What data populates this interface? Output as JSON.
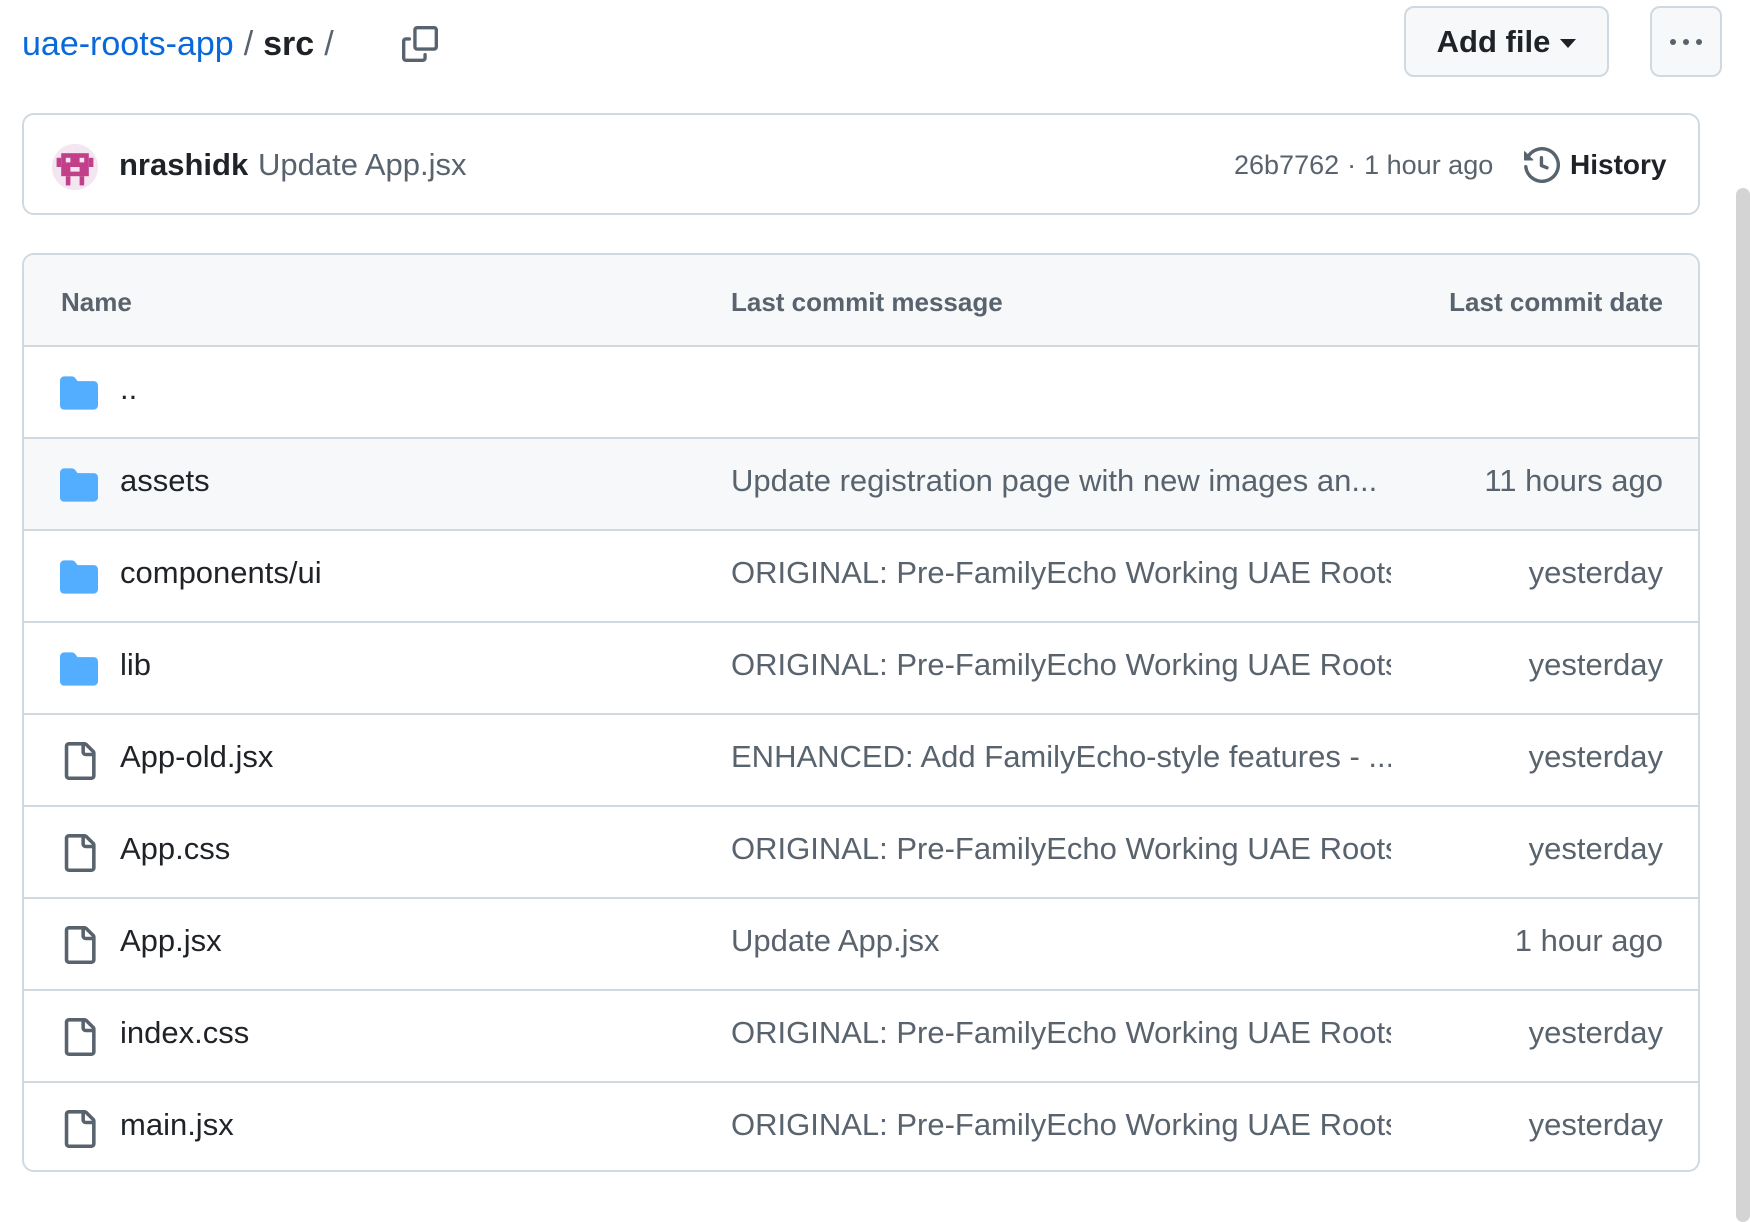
{
  "breadcrumb": {
    "repo": "uae-roots-app",
    "separator": "/",
    "directory": "src",
    "trailing_separator": "/"
  },
  "icons": {
    "copy": "copy-icon",
    "caret": "triangle-down-icon",
    "more": "kebab-horizontal-icon",
    "history": "history-icon",
    "folder": "folder-icon",
    "file": "file-icon"
  },
  "toolbar": {
    "add_file_label": "Add file"
  },
  "latest_commit": {
    "author": "nrashidk",
    "message": "Update App.jsx",
    "sha": "26b7762",
    "separator": "·",
    "time": "1 hour ago",
    "history_label": "History"
  },
  "table": {
    "headers": {
      "name": "Name",
      "message": "Last commit message",
      "date": "Last commit date"
    },
    "parent_dir": "..",
    "rows": [
      {
        "type": "folder",
        "name": "assets",
        "message": "Update registration page with new images an...",
        "date": "11 hours ago"
      },
      {
        "type": "folder",
        "name": "components/ui",
        "message": "ORIGINAL: Pre-FamilyEcho Working UAE Roots",
        "date": "yesterday"
      },
      {
        "type": "folder",
        "name": "lib",
        "message": "ORIGINAL: Pre-FamilyEcho Working UAE Roots",
        "date": "yesterday"
      },
      {
        "type": "file",
        "name": "App-old.jsx",
        "message": "ENHANCED: Add FamilyEcho-style features - ...",
        "date": "yesterday"
      },
      {
        "type": "file",
        "name": "App.css",
        "message": "ORIGINAL: Pre-FamilyEcho Working UAE Roots",
        "date": "yesterday"
      },
      {
        "type": "file",
        "name": "App.jsx",
        "message": "Update App.jsx",
        "date": "1 hour ago"
      },
      {
        "type": "file",
        "name": "index.css",
        "message": "ORIGINAL: Pre-FamilyEcho Working UAE Roots",
        "date": "yesterday"
      },
      {
        "type": "file",
        "name": "main.jsx",
        "message": "ORIGINAL: Pre-FamilyEcho Working UAE Roots",
        "date": "yesterday"
      }
    ]
  },
  "colors": {
    "link": "#0969da",
    "folder": "#54aeff",
    "muted_text": "#59636e",
    "border": "#d1d9e0",
    "avatar": "#c2408a"
  }
}
